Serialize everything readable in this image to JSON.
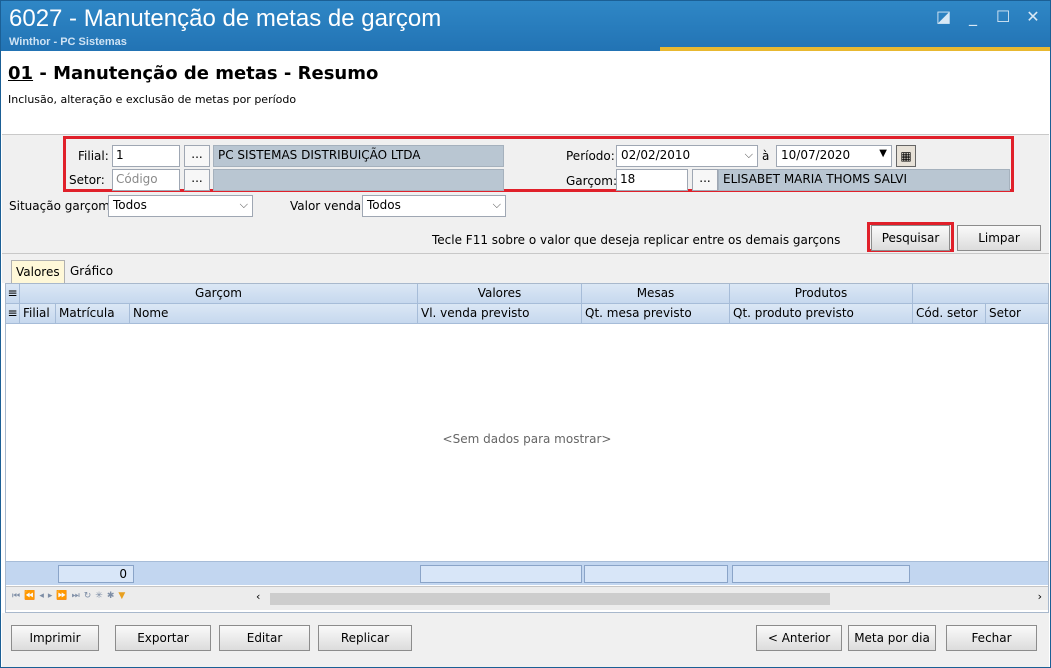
{
  "window": {
    "title": "6027 - Manutenção de metas de garçom",
    "subtitle": "Winthor - PC Sistemas"
  },
  "header": {
    "title_number": "01",
    "title_text": " - Manutenção de metas - Resumo",
    "description": "Inclusão, alteração e exclusão de metas por período"
  },
  "filters": {
    "filial_label": "Filial:",
    "filial_value": "1",
    "filial_name": "PC SISTEMAS DISTRIBUIÇÃO LTDA",
    "setor_label": "Setor:",
    "setor_placeholder": "Código",
    "setor_name": "",
    "periodo_label": "Período:",
    "periodo_start": "02/02/2010",
    "periodo_sep": "à",
    "periodo_end": "10/07/2020",
    "garcom_label": "Garçom:",
    "garcom_value": "18",
    "garcom_name": "ELISABET MARIA THOMS SALVI",
    "situacao_label": "Situação garçom:",
    "situacao_value": "Todos",
    "valor_venda_label": "Valor venda:",
    "valor_venda_value": "Todos",
    "dots": "..."
  },
  "hint": "Tecle F11 sobre o valor que deseja replicar entre os demais garçons",
  "actions": {
    "pesquisar": "Pesquisar",
    "limpar": "Limpar"
  },
  "tabs": [
    "Valores",
    "Gráfico"
  ],
  "grid": {
    "band_headers": [
      "Garçom",
      "Valores",
      "Mesas",
      "Produtos"
    ],
    "columns": [
      "Filial",
      "Matrícula",
      "Nome",
      "Vl. venda previsto",
      "Qt. mesa previsto",
      "Qt. produto previsto",
      "Cód. setor",
      "Setor"
    ],
    "empty_text": "<Sem dados para mostrar>",
    "footer_count": "0"
  },
  "bottom_buttons": {
    "imprimir": "Imprimir",
    "exportar": "Exportar",
    "editar": "Editar",
    "replicar": "Replicar",
    "anterior": "< Anterior",
    "meta_por_dia": "Meta por dia",
    "fechar": "Fechar"
  },
  "colors": {
    "titlebar": "#2a7dbf",
    "highlight": "#e0202a",
    "grid_header": "#c6d8ee"
  }
}
